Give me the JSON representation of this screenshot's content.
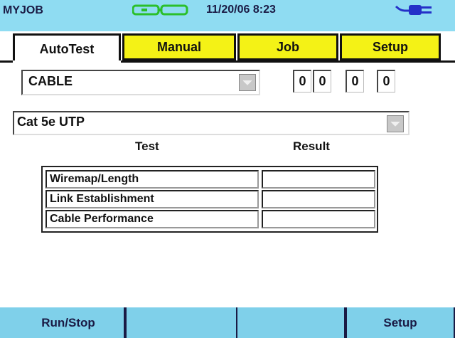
{
  "header": {
    "app_title": "MYJOB",
    "datetime": "11/20/06 8:23",
    "battery_icon": "battery-icon",
    "power_icon": "power-plug-icon"
  },
  "tabs": [
    {
      "label": "AutoTest",
      "active": true
    },
    {
      "label": "Manual",
      "active": false
    },
    {
      "label": "Job",
      "active": false
    },
    {
      "label": "Setup",
      "active": false
    }
  ],
  "test_type": {
    "value": "CABLE"
  },
  "counter": [
    "0",
    "0",
    "0",
    "0"
  ],
  "cable_type": {
    "value": "Cat 5e UTP"
  },
  "table": {
    "headers": {
      "test": "Test",
      "result": "Result"
    },
    "rows": [
      {
        "test": "Wiremap/Length",
        "result": ""
      },
      {
        "test": "Link Establishment",
        "result": ""
      },
      {
        "test": "Cable Performance",
        "result": ""
      }
    ]
  },
  "softkeys": [
    {
      "label": "Run/Stop"
    },
    {
      "label": ""
    },
    {
      "label": ""
    },
    {
      "label": "Setup"
    }
  ],
  "colors": {
    "title_bar": "#8fdcf2",
    "tab_inactive": "#f4f216",
    "softkey_bar": "#7fd0ea",
    "icon_green": "#2bbf2b",
    "icon_blue": "#2430c8"
  }
}
